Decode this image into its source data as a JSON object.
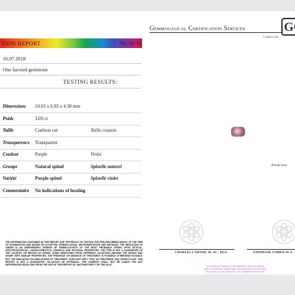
{
  "brand": {
    "name": "Gemmological Certification Services",
    "location": "London UK",
    "logo_letters": "GC"
  },
  "report": {
    "title": "TION REPORT",
    "number": "78158-70",
    "date": "16.07.2018",
    "description": "One faceted gemstone",
    "section_title": "TESTING RESULTS:"
  },
  "results": [
    {
      "label": "Dimensions",
      "value": "10.63 x 6.93 x 4.58 mm",
      "alt": ""
    },
    {
      "label": "Poids",
      "value": "3.09 ct",
      "alt": ""
    },
    {
      "label": "Taille",
      "value": "Cushion cut",
      "alt": "Taille coussin"
    },
    {
      "label": "Transparence",
      "value": "Transparent",
      "alt": ""
    },
    {
      "label": "Couleur",
      "value": "Purple",
      "alt": "Violet"
    },
    {
      "label": "Groupe",
      "value": "Natural spinel",
      "alt": "Spinelle naturel"
    },
    {
      "label": "Variété",
      "value": "Purple spinel",
      "alt": "Spinelle violet"
    },
    {
      "label": "Commentaire",
      "value": "No indications of heating",
      "alt": ""
    }
  ],
  "gem": {
    "caption": "Actual size",
    "color": "#b07891"
  },
  "disclaimer": "THE INFORMATION CONTAINED IN THIS REPORT ARE THE RESULT OF TESTING THE ITEM DESCRIBED ABOVE, AT THE TIME OF EXAMINATION AND BASED ON ACCEPTED GEMMOLOGICAL INSTRUMENTATION AND METHODS. THE INDICATION OF ORIGIN IS AN INDEPENDENT OPINION OF GEMMOLOGISTS OF THE MOST PROBABLE ORIGIN UPON OPTICAL, SPECTROSCOPICAL, CHARACTERISTICS, CHEMICAL AND PHYSICAL PROPERTIES. THE ITEM IS NOT A GUARANTEE OF THE COUNTRY OR REGION OF ORIGIN. SOME GEMSTONES FROM DIFFERENT LOCATIONS AROUND THE WORLD MAY SHARE VERY SIMILAR PROPERTIES. THE PRESENCE OR ABSENCE OF TREATMENT IS POSSIBLE OTHERWISE NOTABLE, BUT THE INDICATION 'NO INDICATIONS OF TREATMENT' DOES NOT IMPLY THAT NO TREATMENT HAS TAKEN PLACE. THIS REPORT IS NOT A GUARANTEE, VALUATION OR APPRAISAL. THE COMPANY SHALL NOT BE LIABLE FOR ANY DIFFERENCES RESULTING FROM THE USE OF THIS REPORT BY ANOTHER PARTY OR THE SALE.",
  "signatories": [
    {
      "name": "CHARLES CARTER, M. SC., DUG"
    },
    {
      "name": "STEPHANE COHEN-SCA"
    }
  ],
  "pink_note": "THIS REPORT DOES NOT REPRESENT THE DOCUMENT FOR A CERTIFIED GEMSTONE, AND SHOULD NOT BE USED IN PLACE OF THE ORIGINAL. ANY ALTERATION TO THIS DOCUMENT WILL RENDER IT VOID."
}
